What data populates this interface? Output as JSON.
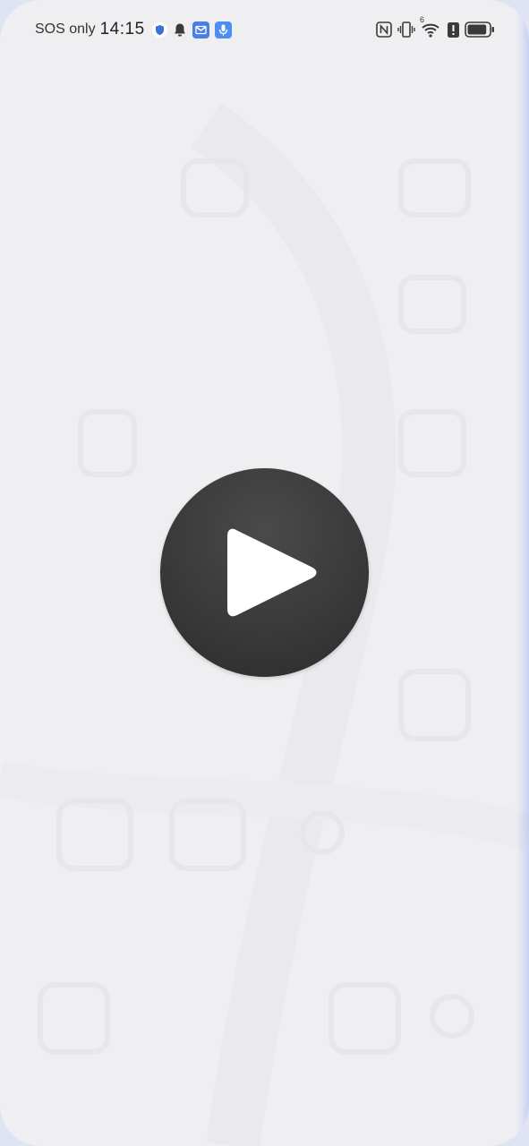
{
  "status_bar": {
    "carrier": "SOS only",
    "time": "14:15",
    "left_icons": [
      "shield-icon",
      "bell-icon",
      "mail-app-icon",
      "mic-app-icon"
    ],
    "right_icons": [
      "nfc-icon",
      "vibrate-icon",
      "wifi-icon",
      "alert-icon",
      "battery-icon"
    ],
    "wifi_badge": "6",
    "battery_level": 0.9
  },
  "main": {
    "play_button": {
      "icon": "play-icon",
      "color": "#3a3a3a"
    }
  },
  "colors": {
    "background": "#efeff2",
    "accent_blue": "#4a7ee8"
  }
}
